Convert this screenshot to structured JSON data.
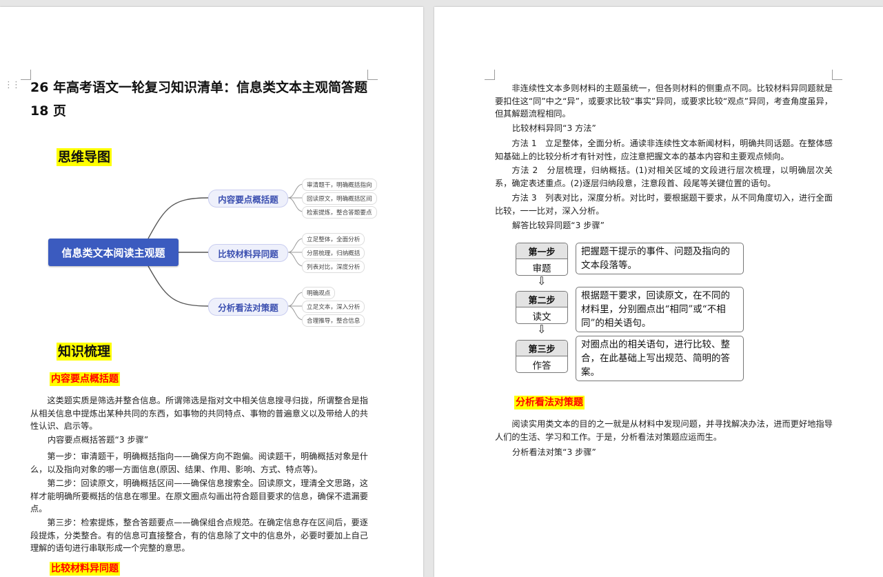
{
  "page1": {
    "title": "26 年高考语文一轮复习知识清单：信息类文本主观简答题 18 页",
    "section_mindmap": "思维导图",
    "mindmap": {
      "root": "信息类文本阅读主观题",
      "branches": [
        {
          "label": "内容要点概括题",
          "leaves": [
            "审清题干，明确概括指向",
            "回读原文，明确概括区间",
            "检索提炼，整合答题要点"
          ]
        },
        {
          "label": "比较材料异同题",
          "leaves": [
            "立足整体，全面分析",
            "分层梳理，归纳概括",
            "列表对比，深度分析"
          ]
        },
        {
          "label": "分析看法对策题",
          "leaves": [
            "明确观点",
            "立足文本，深入分析",
            "合理推导，整合信息"
          ]
        }
      ]
    },
    "section_knowledge": "知识梳理",
    "sub1": "内容要点概括题",
    "p1": "这类题实质是筛选并整合信息。所谓筛选是指对文中相关信息搜寻归拢，所谓整合是指从相关信息中提炼出某种共同的东西，如事物的共同特点、事物的普遍意义以及带给人的共性认识、启示等。",
    "p2": "内容要点概括答题“3 步骤”",
    "p3": "第一步：审清题干，明确概括指向——确保方向不跑偏。阅读题干，明确概括对象是什么，以及指向对象的哪一方面信息(原因、结果、作用、影响、方式、特点等)。",
    "p4": "第二步：回读原文，明确概括区间——确保信息搜索全。回读原文，理清全文思路，这样才能明确所要概括的信息在哪里。在原文圈点勾画出符合题目要求的信息，确保不遗漏要点。",
    "p5": "第三步：检索提炼，整合答题要点——确保组合点规范。在确定信息存在区间后，要逐段提炼，分类整合。有的信息可直接整合，有的信息除了文中的信息外，必要时要加上自己理解的语句进行串联形成一个完整的意思。",
    "sub2": "比较材料异同题"
  },
  "page2": {
    "p1": "非连续性文本多则材料的主题虽统一，但各则材料的侧重点不同。比较材料异同题就是要扣住这“同”中之“异”，或要求比较“事实”异同，或要求比较“观点”异同，考查角度虽异，但其解题流程相同。",
    "p2": "比较材料异同“3 方法”",
    "p3": "方法 1　立足整体，全面分析。通读非连续性文本新闻材料，明确共同话题。在整体感知基础上的比较分析才有针对性，应注意把握文本的基本内容和主要观点倾向。",
    "p4": "方法 2　分层梳理，归纳概括。(1)对相关区域的文段进行层次梳理，以明确层次关系，确定表述重点。(2)逐层归纳段意，注意段首、段尾等关键位置的语句。",
    "p5": "方法 3　列表对比，深度分析。对比时，要根据题干要求，从不同角度切入，进行全面比较，一一比对，深入分析。",
    "p6": "解答比较异同题“3 步骤”",
    "flow": [
      {
        "step": "第一步",
        "name": "审题",
        "desc": "把握题干提示的事件、问题及指向的文本段落等。"
      },
      {
        "step": "第二步",
        "name": "读文",
        "desc": "根据题干要求，回读原文，在不同的材料里，分别圈点出“相同”或“不相同”的相关语句。"
      },
      {
        "step": "第三步",
        "name": "作答",
        "desc": "对圈点出的相关语句，进行比较、整合，在此基础上写出规范、简明的答案。"
      }
    ],
    "sub3": "分析看法对策题",
    "p7": "阅读实用类文本的目的之一就是从材料中发现问题，并寻找解决办法，进而更好地指导人们的生活、学习和工作。于是，分析看法对策题应运而生。",
    "p8": "分析看法对策“3 步骤”"
  }
}
